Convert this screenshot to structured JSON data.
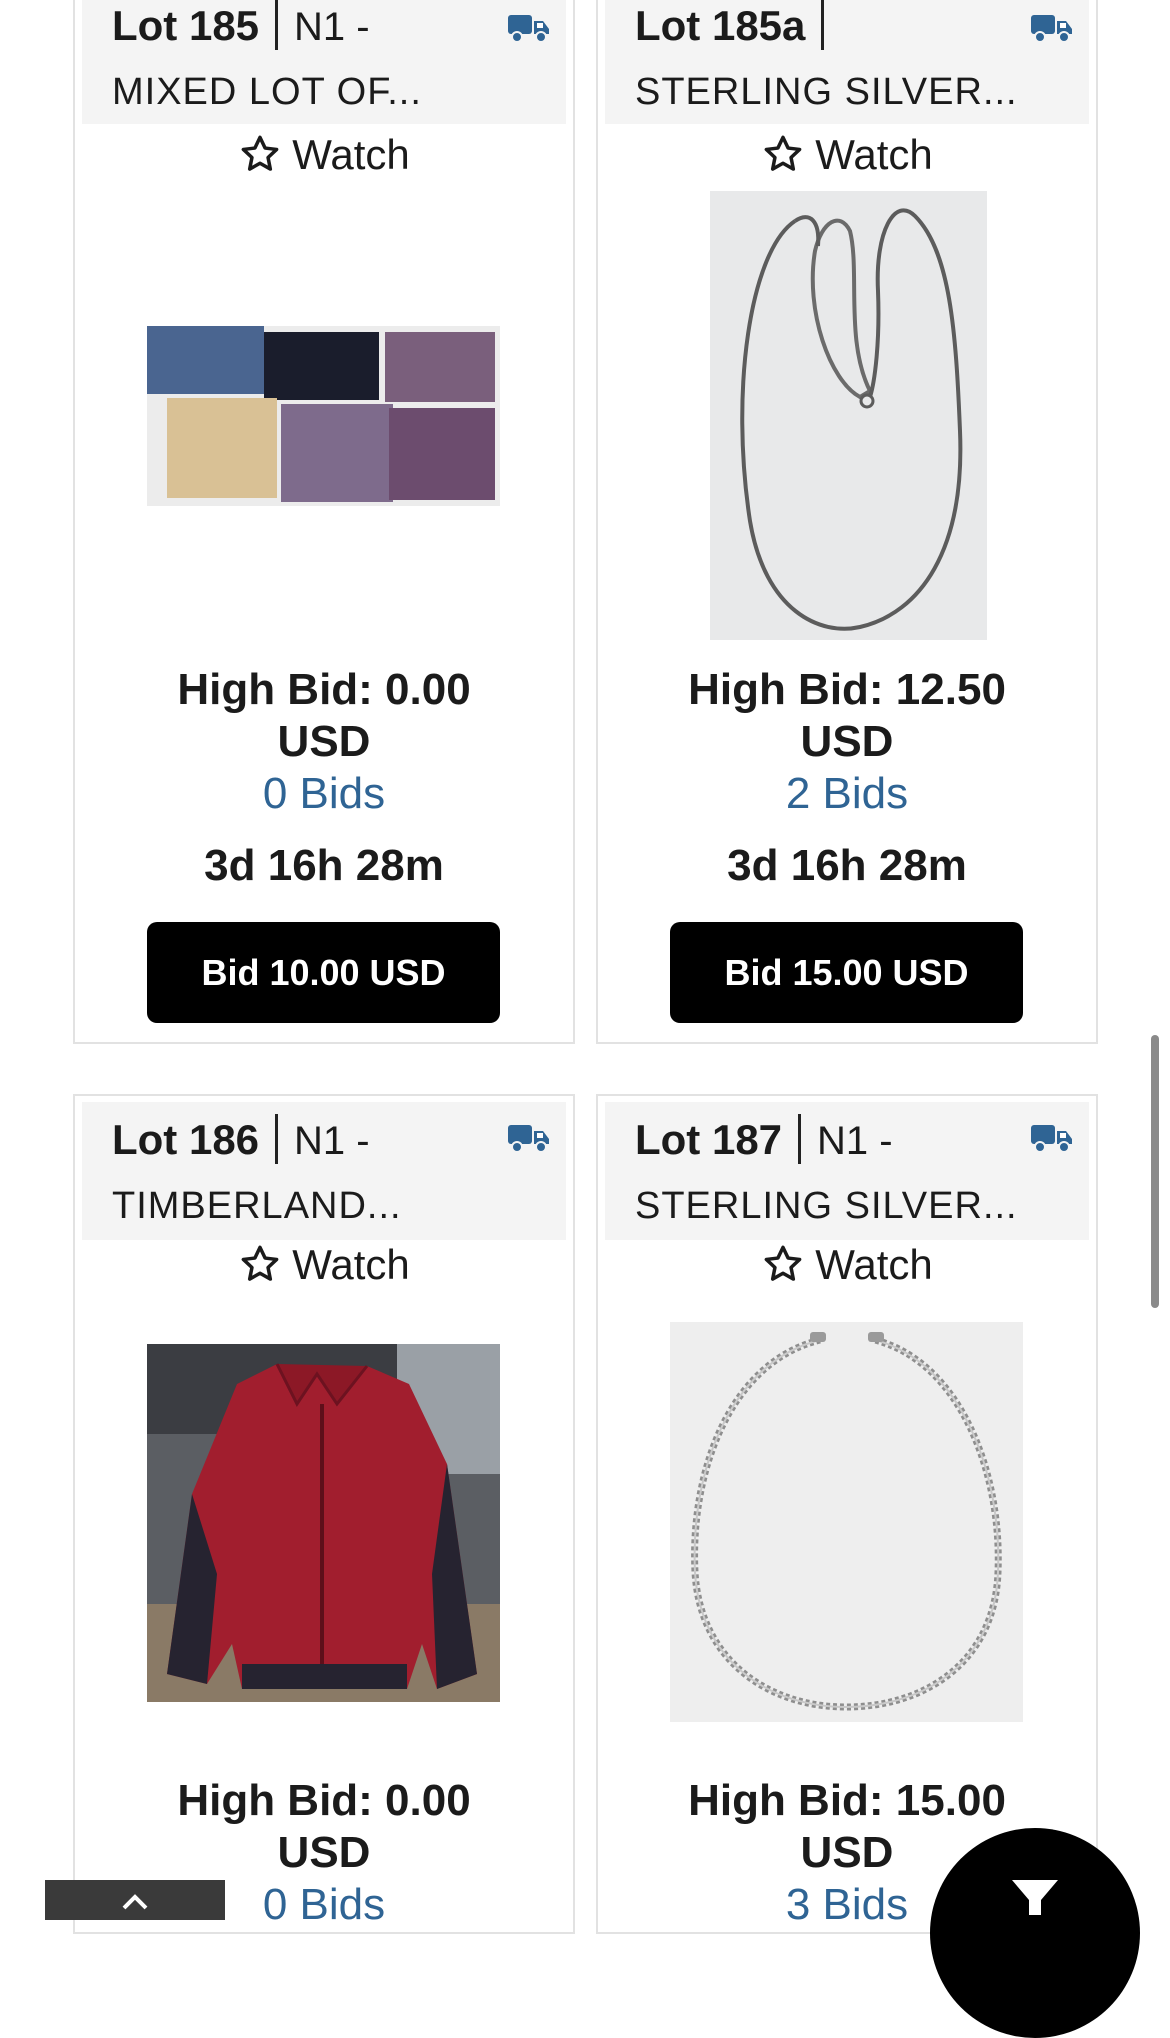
{
  "lots": [
    {
      "lot_label": "Lot 185",
      "code": "N1 -",
      "title": "MIXED LOT OF...",
      "watch_label": "Watch",
      "high_bid_label": "High Bid: 0.00",
      "currency": "USD",
      "bids_label": "0 Bids",
      "time_left": "3d 16h 28m",
      "bid_button_label": "Bid 10.00 USD",
      "shipping_icon": "truck-icon",
      "photo": "clothing-lot-photo"
    },
    {
      "lot_label": "Lot 185a",
      "code": "",
      "title": "STERLING SILVER...",
      "watch_label": "Watch",
      "high_bid_label": "High Bid: 12.50",
      "currency": "USD",
      "bids_label": "2 Bids",
      "time_left": "3d 16h 28m",
      "bid_button_label": "Bid 15.00 USD",
      "shipping_icon": "truck-icon",
      "photo": "silver-chain-photo"
    },
    {
      "lot_label": "Lot 186",
      "code": "N1 -",
      "title": "TIMBERLAND...",
      "watch_label": "Watch",
      "high_bid_label": "High Bid: 0.00",
      "currency": "USD",
      "bids_label": "0 Bids",
      "shipping_icon": "truck-icon",
      "photo": "red-jacket-photo"
    },
    {
      "lot_label": "Lot 187",
      "code": "N1 -",
      "title": "STERLING SILVER...",
      "watch_label": "Watch",
      "high_bid_label": "High Bid: 15.00",
      "currency": "USD",
      "bids_label": "3 Bids",
      "shipping_icon": "truck-icon",
      "photo": "curb-chain-photo"
    }
  ],
  "colors": {
    "link_blue": "#2f6494",
    "truck_blue": "#2f6494",
    "button_bg": "#000000",
    "header_bg": "#f4f4f4",
    "card_border": "#e2e2e2"
  },
  "floating": {
    "filter_icon": "filter-icon",
    "back_to_top_icon": "chevron-up-icon"
  }
}
